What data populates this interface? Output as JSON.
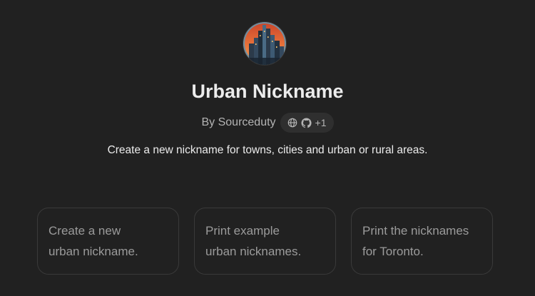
{
  "gpt": {
    "name": "Urban Nickname",
    "author": "By Sourceduty",
    "links_extra": "+1",
    "description": "Create a new nickname for towns, cities and urban or rural areas.",
    "avatar_icon": "city-skyline-avatar",
    "link_icons": [
      "globe-icon",
      "github-icon"
    ]
  },
  "starters": [
    {
      "line1": "Create a new",
      "line2": "urban nickname."
    },
    {
      "line1": "Print example",
      "line2": "urban nicknames."
    },
    {
      "line1": "Print the nicknames",
      "line2": "for Toronto."
    }
  ],
  "colors": {
    "background": "#212121",
    "card_border": "#3a3a3a",
    "pill_bg": "#2f2f2f",
    "muted_text": "#b4b4b4"
  }
}
